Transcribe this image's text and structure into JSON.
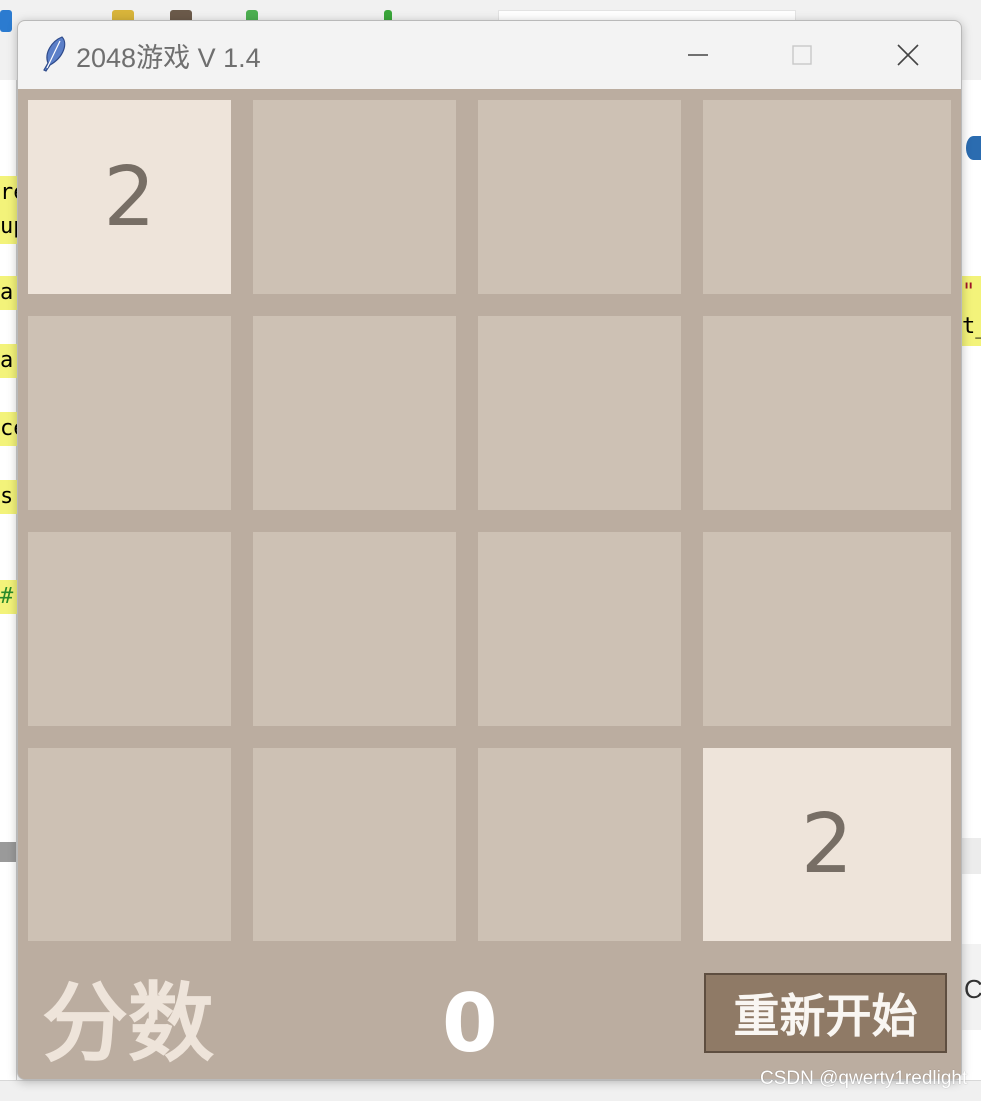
{
  "colors": {
    "board_bg": "#bbada0",
    "empty_cell": "#cdc1b4",
    "tile_2": "#eee4da",
    "tile_text": "#776e65",
    "score_label": "#eee4da",
    "restart_button": "#8f7a66",
    "titlebar_bg": "#f3f3f3"
  },
  "window": {
    "title": "2048游戏 V 1.4",
    "icon": "feather-icon",
    "controls": [
      "minimize-icon",
      "maximize-icon",
      "close-icon"
    ]
  },
  "board": {
    "rows": [
      [
        "2",
        "",
        "",
        ""
      ],
      [
        "",
        "",
        "",
        ""
      ],
      [
        "",
        "",
        "",
        ""
      ],
      [
        "",
        "",
        "",
        "2"
      ]
    ]
  },
  "footer": {
    "score_label": "分数",
    "score_value": "0",
    "restart_label": "重新开始"
  },
  "watermark": "CSDN @qwerty1redlight",
  "background": {
    "code_fragments": [
      "re",
      "up",
      "ar",
      "ar",
      "ce",
      "s.m",
      "#"
    ],
    "right_fragments": [
      "\"",
      "t_"
    ],
    "right_band_text": "C"
  }
}
